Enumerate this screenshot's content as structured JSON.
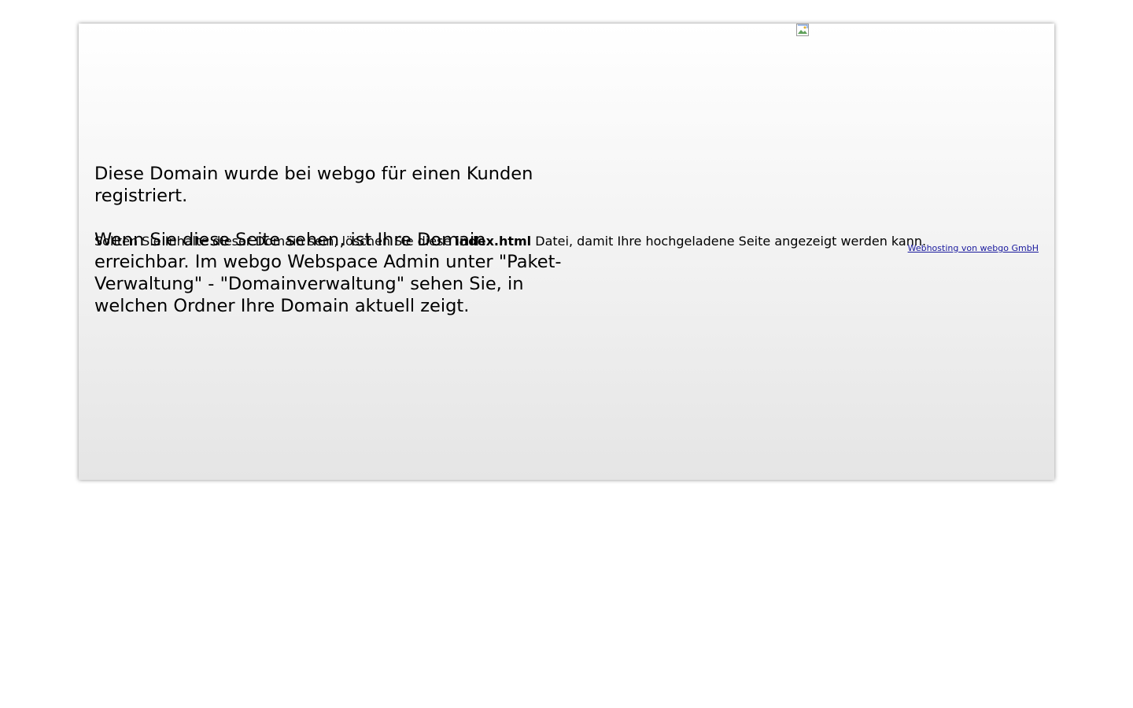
{
  "headline": {
    "line1": "Diese Domain wurde bei webgo für einen Kunden registriert.",
    "line2": "Wenn Sie diese Seite sehen, ist Ihre Domain erreichbar. Im webgo Webspace Admin unter \"Paket-Verwaltung\" - \"Domainverwaltung\" sehen Sie, in welchen Ordner Ihre Domain aktuell zeigt."
  },
  "instruction": {
    "before": "Sollten Sie Inhalte dieser Domain sein, löschen Sie diese ",
    "filename": "index.html",
    "after": " Datei, damit Ihre hochgeladene Seite angezeigt werden kann."
  },
  "footer": {
    "credit_link": "Webhosting von webgo GmbH"
  },
  "icons": {
    "broken_image": "broken-image-icon"
  }
}
